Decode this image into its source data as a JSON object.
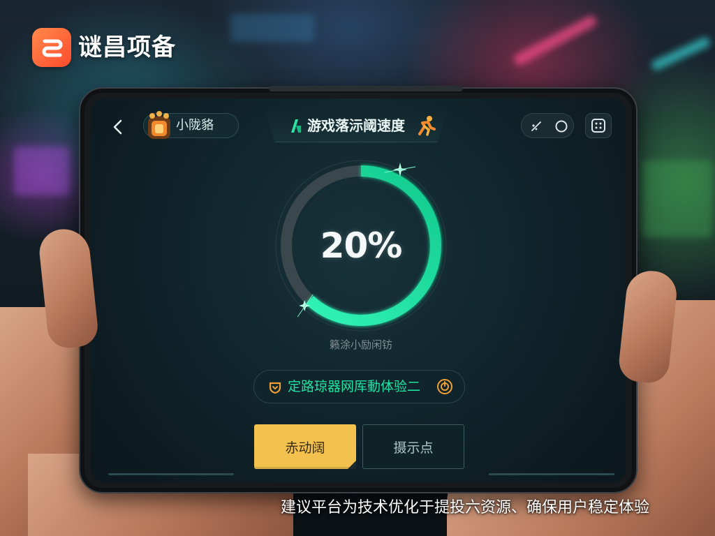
{
  "brand": {
    "name": "谜昌项备",
    "icon": "brand-logo-icon"
  },
  "app": {
    "back_icon": "chevron-left-icon",
    "game_tag": "小陇貉",
    "game_icon": "game-avatar-icon",
    "title": "游戏落沶阈速度",
    "title_icons": [
      "accelerate-icon",
      "runner-icon"
    ],
    "tool_icons": [
      "signal-icon",
      "circle-icon",
      "grid-dots-icon"
    ],
    "progress_text": "20%",
    "ring_fill": 0.62,
    "status_text": "籁涂小励闲钫",
    "notice_text": "定路琼器网厍動体验二",
    "notice_icons": [
      "shield-icon",
      "power-icon"
    ],
    "primary_button": "赤动阔",
    "secondary_button": "摄示点"
  },
  "caption": "建议平台为技术优化于提投六资源、确保用户稳定体验",
  "colors": {
    "accent": "#1fe3a3",
    "button": "#f2c14e",
    "warning": "#f0a033",
    "screen": "#0f2128"
  }
}
